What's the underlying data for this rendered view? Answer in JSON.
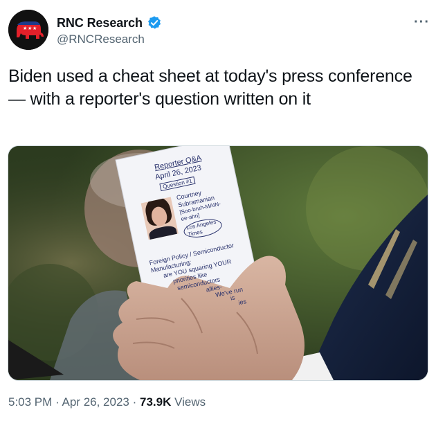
{
  "author": {
    "name": "RNC Research",
    "handle": "@RNCResearch",
    "verified": true,
    "avatar_icon": "gop-elephant-icon",
    "avatar_color": "#111111",
    "verified_color": "#1d9bf0"
  },
  "more_icon": "more-options-icon",
  "tweet": {
    "text": "Biden used a cheat sheet at today's press conference — with a reporter's question written on it"
  },
  "card": {
    "title": "Reporter Q&A",
    "date": "April 26, 2023",
    "question_label": "Question #1",
    "reporter_name": "Courtney",
    "reporter_surname": "Subramanian",
    "pronunciation": "[Soo-bruh-MAIN-ee-ahn]",
    "outlet": "Los Angeles Times",
    "topic": "Foreign Policy / Semiconductor Manufacturing:",
    "question_lines": [
      "are YOU squaring YOUR",
      "priorities like",
      "semiconductors",
      "allies-",
      "We've run",
      "is",
      "ies"
    ]
  },
  "meta": {
    "time": "5:03 PM",
    "separator": "·",
    "date": "Apr 26, 2023",
    "views_count": "73.9K",
    "views_label": "Views"
  }
}
